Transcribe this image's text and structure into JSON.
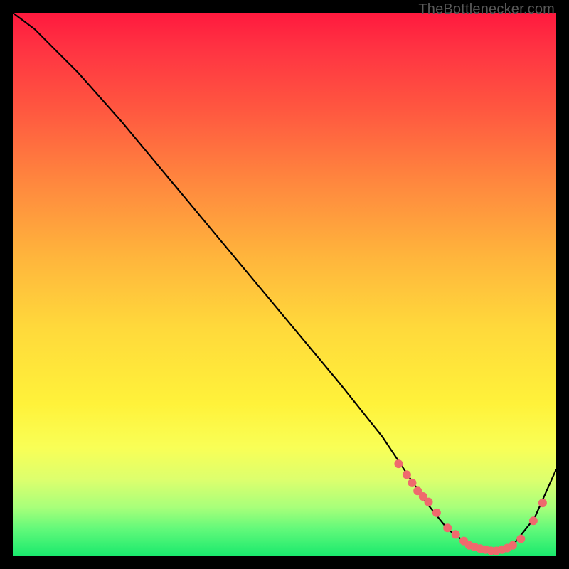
{
  "attribution": "TheBottlenecker.com",
  "colors": {
    "frame": "#000000",
    "curve": "#000000",
    "dots": "#ef6a6d",
    "attribution_text": "#595959",
    "gradient_stops": [
      "#ff193e",
      "#ff3142",
      "#ff5840",
      "#ff8a3e",
      "#ffb53c",
      "#ffd93b",
      "#fff23a",
      "#f9ff56",
      "#dcff6e",
      "#a8ff7a",
      "#62f97a",
      "#19e96d"
    ]
  },
  "chart_data": {
    "type": "line",
    "title": "",
    "xlabel": "",
    "ylabel": "",
    "xlim": [
      0,
      100
    ],
    "ylim": [
      0,
      100
    ],
    "series": [
      {
        "name": "bottleneck-curve",
        "x": [
          0,
          4,
          8,
          12,
          20,
          30,
          40,
          50,
          60,
          68,
          72,
          76,
          80,
          84,
          88,
          92,
          96,
          100
        ],
        "y": [
          100,
          97,
          93,
          89,
          80,
          68,
          56,
          44,
          32,
          22,
          16,
          10,
          5,
          2,
          1,
          2,
          7,
          16
        ]
      }
    ],
    "markers": {
      "name": "highlight-dots",
      "x": [
        71,
        72.5,
        73.5,
        74.5,
        75.5,
        76.5,
        78,
        80,
        81.5,
        83,
        84,
        85,
        86,
        87,
        88,
        89,
        90,
        91,
        92,
        93.5,
        95.8,
        97.5
      ],
      "y": [
        17,
        15,
        13.5,
        12,
        11,
        10,
        8,
        5.2,
        4,
        2.8,
        2,
        1.7,
        1.4,
        1.2,
        1.0,
        1.0,
        1.2,
        1.5,
        2.0,
        3.2,
        6.5,
        9.8
      ]
    }
  }
}
